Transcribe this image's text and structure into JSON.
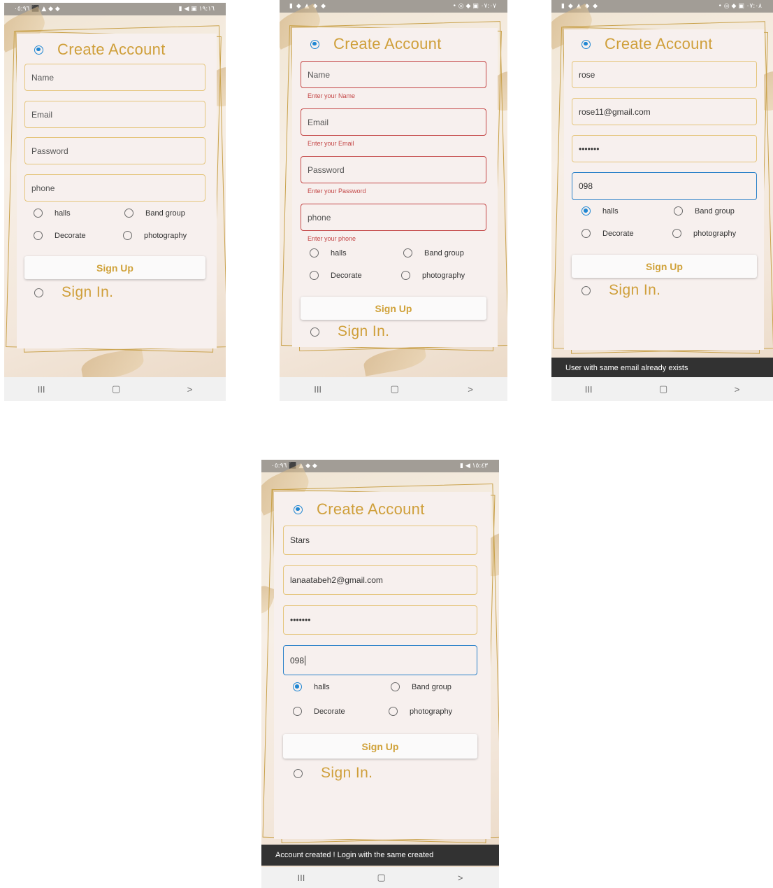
{
  "screens": [
    {
      "status_left": "۰٥:٩٦ ⬛ ▲ ◆ ◆",
      "status_right": "▮ ◀ ▣ ١٩:١٦",
      "title": "Create Account",
      "fields": [
        {
          "text": "Name"
        },
        {
          "text": "Email"
        },
        {
          "text": "Password"
        },
        {
          "text": "phone"
        }
      ],
      "options": [
        "halls",
        "Band group",
        "Decorate",
        "photography"
      ],
      "signup": "Sign Up",
      "signin": "Sign In."
    },
    {
      "status_left": "▮ ◆ ▲ ◆ ◆",
      "status_right": "• ◎ ◆ ▣ ٠٧:٠٧",
      "title": "Create Account",
      "fields": [
        {
          "text": "Name",
          "error": "Enter your Name"
        },
        {
          "text": "Email",
          "error": "Enter your Email"
        },
        {
          "text": "Password",
          "error": "Enter your Password"
        },
        {
          "text": "phone",
          "error": "Enter your phone"
        }
      ],
      "options": [
        "halls",
        "Band group",
        "Decorate",
        "photography"
      ],
      "signup": "Sign Up",
      "signin": "Sign In."
    },
    {
      "status_left": "▮ ◆ ▲ ◆ ◆",
      "status_right": "• ◎ ◆ ▣ ٠٧:٠٨",
      "title": "Create Account",
      "fields": [
        {
          "text": "rose"
        },
        {
          "text": "rose11@gmail.com"
        },
        {
          "text": "•••••••"
        },
        {
          "text": "098"
        }
      ],
      "options": [
        "halls",
        "Band group",
        "Decorate",
        "photography"
      ],
      "signup": "Sign Up",
      "signin": "Sign In.",
      "snackbar": "User with same email already exists"
    },
    {
      "status_left": "۰٥:٩٦ ⬛ ▲ ◆ ◆",
      "status_right": "▮ ◀ ١٥:٤٣",
      "title": "Create Account",
      "fields": [
        {
          "text": "Stars"
        },
        {
          "text": "lanaatabeh2@gmail.com"
        },
        {
          "text": "•••••••"
        },
        {
          "text": "098"
        }
      ],
      "options": [
        "halls",
        "Band group",
        "Decorate",
        "photography"
      ],
      "signup": "Sign Up",
      "signin": "Sign In.",
      "snackbar": "Account created ! Login with the same created"
    }
  ],
  "nav": {
    "recent": "III",
    "home": "▢",
    "back": ">"
  },
  "colors": {
    "accent_gold": "#cf9f3a",
    "field_border": "#e5c57c",
    "radio_blue": "#1f86d2",
    "error_red": "#c44747",
    "snackbar_bg": "#323232"
  },
  "icons": [
    "radio-selected-icon",
    "radio-unselected-icon",
    "recent-apps-icon",
    "home-icon",
    "back-icon"
  ]
}
